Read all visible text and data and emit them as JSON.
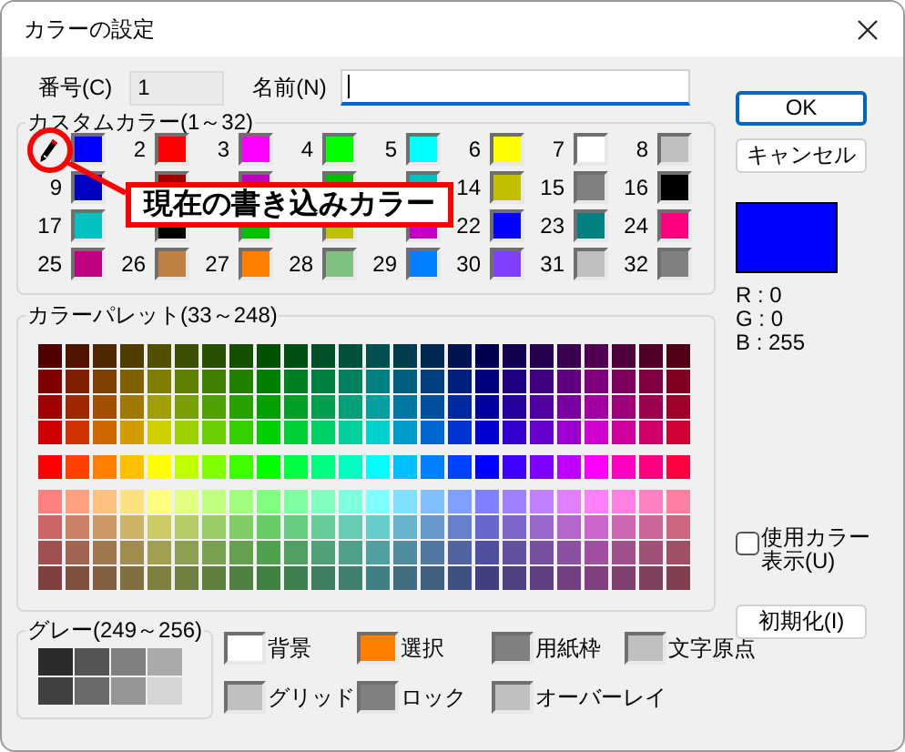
{
  "window": {
    "title": "カラーの設定"
  },
  "number_field": {
    "label": "番号(C)",
    "value": "1"
  },
  "name_field": {
    "label": "名前(N)",
    "focused": true
  },
  "custom_colors": {
    "title": "カスタムカラー(1～32)",
    "cells": [
      {
        "kind": "current",
        "color": "#0000ff"
      },
      {
        "kind": "number",
        "label": "2",
        "color": "#ff0000"
      },
      {
        "kind": "number",
        "label": "3",
        "color": "#ff00ff"
      },
      {
        "kind": "number",
        "label": "4",
        "color": "#00ff00"
      },
      {
        "kind": "number",
        "label": "5",
        "color": "#00ffff"
      },
      {
        "kind": "number",
        "label": "6",
        "color": "#ffff00"
      },
      {
        "kind": "number",
        "label": "7",
        "color": "#ffffff"
      },
      {
        "kind": "number",
        "label": "8",
        "color": "#c0c0c0"
      },
      {
        "kind": "number",
        "label": "9",
        "color": "#0000c0"
      },
      {
        "kind": "covered",
        "color": "#a00000"
      },
      {
        "kind": "covered",
        "color": "#c000c0"
      },
      {
        "kind": "covered",
        "color": "#00c000"
      },
      {
        "kind": "covered",
        "color": "#00c0c0"
      },
      {
        "kind": "number",
        "label": "14",
        "color": "#c0c000"
      },
      {
        "kind": "number",
        "label": "15",
        "color": "#808080"
      },
      {
        "kind": "number",
        "label": "16",
        "color": "#000000"
      },
      {
        "kind": "number",
        "label": "17",
        "color": "#00c0c0"
      },
      {
        "kind": "covered",
        "color": "#000000"
      },
      {
        "kind": "covered",
        "color": "#00c000"
      },
      {
        "kind": "covered",
        "color": "#c0c000"
      },
      {
        "kind": "covered",
        "color": "#c000c0"
      },
      {
        "kind": "number",
        "label": "22",
        "color": "#0000ff"
      },
      {
        "kind": "number",
        "label": "23",
        "color": "#008080"
      },
      {
        "kind": "number",
        "label": "24",
        "color": "#ff0080"
      },
      {
        "kind": "number",
        "label": "25",
        "color": "#c00080"
      },
      {
        "kind": "number",
        "label": "26",
        "color": "#c08040"
      },
      {
        "kind": "number",
        "label": "27",
        "color": "#ff8000"
      },
      {
        "kind": "number",
        "label": "28",
        "color": "#80c080"
      },
      {
        "kind": "number",
        "label": "29",
        "color": "#0080ff"
      },
      {
        "kind": "number",
        "label": "30",
        "color": "#8040ff"
      },
      {
        "kind": "number",
        "label": "31",
        "color": "#c0c0c0"
      },
      {
        "kind": "number",
        "label": "32",
        "color": "#808080"
      }
    ],
    "callout": "現在の書き込みカラー"
  },
  "palette": {
    "title": "カラーパレット(33～248)",
    "bands": [
      {
        "rows": [
          {
            "cells": [
              {
                "color": "#500000"
              },
              {
                "color": "#501400"
              },
              {
                "color": "#502800"
              },
              {
                "color": "#503c00"
              },
              {
                "color": "#505000"
              },
              {
                "color": "#3c5000"
              },
              {
                "color": "#285000"
              },
              {
                "color": "#145000"
              },
              {
                "color": "#005000"
              },
              {
                "color": "#005014"
              },
              {
                "color": "#005028"
              },
              {
                "color": "#00503c"
              },
              {
                "color": "#005050"
              },
              {
                "color": "#003c50"
              },
              {
                "color": "#002850"
              },
              {
                "color": "#001450"
              },
              {
                "color": "#000050"
              },
              {
                "color": "#140050"
              },
              {
                "color": "#280050"
              },
              {
                "color": "#3c0050"
              },
              {
                "color": "#500050"
              },
              {
                "color": "#50003c"
              },
              {
                "color": "#500028"
              },
              {
                "color": "#500014"
              }
            ]
          },
          {
            "cells": [
              {
                "color": "#800000"
              },
              {
                "color": "#802000"
              },
              {
                "color": "#804000"
              },
              {
                "color": "#806000"
              },
              {
                "color": "#808000"
              },
              {
                "color": "#608000"
              },
              {
                "color": "#408000"
              },
              {
                "color": "#208000"
              },
              {
                "color": "#008000"
              },
              {
                "color": "#008020"
              },
              {
                "color": "#008040"
              },
              {
                "color": "#008060"
              },
              {
                "color": "#008080"
              },
              {
                "color": "#006080"
              },
              {
                "color": "#004080"
              },
              {
                "color": "#002080"
              },
              {
                "color": "#000080"
              },
              {
                "color": "#200080"
              },
              {
                "color": "#400080"
              },
              {
                "color": "#600080"
              },
              {
                "color": "#800080"
              },
              {
                "color": "#800060"
              },
              {
                "color": "#800040"
              },
              {
                "color": "#800020"
              }
            ]
          },
          {
            "cells": [
              {
                "color": "#a00000"
              },
              {
                "color": "#a02800"
              },
              {
                "color": "#a05000"
              },
              {
                "color": "#a07800"
              },
              {
                "color": "#a0a000"
              },
              {
                "color": "#78a000"
              },
              {
                "color": "#50a000"
              },
              {
                "color": "#28a000"
              },
              {
                "color": "#00a000"
              },
              {
                "color": "#00a028"
              },
              {
                "color": "#00a050"
              },
              {
                "color": "#00a078"
              },
              {
                "color": "#00a0a0"
              },
              {
                "color": "#0078a0"
              },
              {
                "color": "#0050a0"
              },
              {
                "color": "#0028a0"
              },
              {
                "color": "#0000a0"
              },
              {
                "color": "#2800a0"
              },
              {
                "color": "#5000a0"
              },
              {
                "color": "#7800a0"
              },
              {
                "color": "#a000a0"
              },
              {
                "color": "#a00078"
              },
              {
                "color": "#a00050"
              },
              {
                "color": "#a00028"
              }
            ]
          },
          {
            "cells": [
              {
                "color": "#d00000"
              },
              {
                "color": "#d03400"
              },
              {
                "color": "#d06800"
              },
              {
                "color": "#d09c00"
              },
              {
                "color": "#d0d000"
              },
              {
                "color": "#9cd000"
              },
              {
                "color": "#68d000"
              },
              {
                "color": "#34d000"
              },
              {
                "color": "#00d000"
              },
              {
                "color": "#00d034"
              },
              {
                "color": "#00d068"
              },
              {
                "color": "#00d09c"
              },
              {
                "color": "#00d0d0"
              },
              {
                "color": "#009cd0"
              },
              {
                "color": "#0068d0"
              },
              {
                "color": "#0034d0"
              },
              {
                "color": "#0000d0"
              },
              {
                "color": "#3400d0"
              },
              {
                "color": "#6800d0"
              },
              {
                "color": "#9c00d0"
              },
              {
                "color": "#d000d0"
              },
              {
                "color": "#d0009c"
              },
              {
                "color": "#d00068"
              },
              {
                "color": "#d00034"
              }
            ]
          }
        ]
      },
      {
        "rows": [
          {
            "cells": [
              {
                "color": "#ff0000"
              },
              {
                "color": "#ff4000"
              },
              {
                "color": "#ff8000"
              },
              {
                "color": "#ffc000"
              },
              {
                "color": "#ffff00"
              },
              {
                "color": "#c0ff00"
              },
              {
                "color": "#80ff00"
              },
              {
                "color": "#40ff00"
              },
              {
                "color": "#00ff00"
              },
              {
                "color": "#00ff40"
              },
              {
                "color": "#00ff80"
              },
              {
                "color": "#00ffc0"
              },
              {
                "color": "#00ffff"
              },
              {
                "color": "#00c0ff"
              },
              {
                "color": "#0080ff"
              },
              {
                "color": "#0040ff"
              },
              {
                "color": "#0000ff"
              },
              {
                "color": "#4000ff"
              },
              {
                "color": "#8000ff"
              },
              {
                "color": "#c000ff"
              },
              {
                "color": "#ff00ff"
              },
              {
                "color": "#ff00c0"
              },
              {
                "color": "#ff0080"
              },
              {
                "color": "#ff0040"
              }
            ]
          }
        ]
      },
      {
        "rows": [
          {
            "cells": [
              {
                "color": "#ff8080"
              },
              {
                "color": "#ffa080"
              },
              {
                "color": "#ffc080"
              },
              {
                "color": "#ffe080"
              },
              {
                "color": "#ffff80"
              },
              {
                "color": "#e0ff80"
              },
              {
                "color": "#c0ff80"
              },
              {
                "color": "#a0ff80"
              },
              {
                "color": "#80ff80"
              },
              {
                "color": "#80ffa0"
              },
              {
                "color": "#80ffc0"
              },
              {
                "color": "#80ffe0"
              },
              {
                "color": "#80ffff"
              },
              {
                "color": "#80e0ff"
              },
              {
                "color": "#80c0ff"
              },
              {
                "color": "#80a0ff"
              },
              {
                "color": "#8080ff"
              },
              {
                "color": "#a080ff"
              },
              {
                "color": "#c080ff"
              },
              {
                "color": "#e080ff"
              },
              {
                "color": "#ff80ff"
              },
              {
                "color": "#ff80e0"
              },
              {
                "color": "#ff80c0"
              },
              {
                "color": "#ff80a0"
              }
            ]
          },
          {
            "cells": [
              {
                "color": "#cc6666"
              },
              {
                "color": "#cc8066"
              },
              {
                "color": "#cc9966"
              },
              {
                "color": "#ccb366"
              },
              {
                "color": "#cccc66"
              },
              {
                "color": "#b3cc66"
              },
              {
                "color": "#99cc66"
              },
              {
                "color": "#80cc66"
              },
              {
                "color": "#66cc66"
              },
              {
                "color": "#66cc80"
              },
              {
                "color": "#66cc99"
              },
              {
                "color": "#66ccb3"
              },
              {
                "color": "#66cccc"
              },
              {
                "color": "#66b3cc"
              },
              {
                "color": "#6699cc"
              },
              {
                "color": "#6680cc"
              },
              {
                "color": "#6666cc"
              },
              {
                "color": "#8066cc"
              },
              {
                "color": "#9966cc"
              },
              {
                "color": "#b366cc"
              },
              {
                "color": "#cc66cc"
              },
              {
                "color": "#cc66b3"
              },
              {
                "color": "#cc6699"
              },
              {
                "color": "#cc6680"
              }
            ]
          },
          {
            "cells": [
              {
                "color": "#a05050"
              },
              {
                "color": "#a06450"
              },
              {
                "color": "#a07850"
              },
              {
                "color": "#a08c50"
              },
              {
                "color": "#a0a050"
              },
              {
                "color": "#8ca050"
              },
              {
                "color": "#78a050"
              },
              {
                "color": "#64a050"
              },
              {
                "color": "#50a050"
              },
              {
                "color": "#50a064"
              },
              {
                "color": "#50a078"
              },
              {
                "color": "#50a08c"
              },
              {
                "color": "#50a0a0"
              },
              {
                "color": "#508ca0"
              },
              {
                "color": "#5078a0"
              },
              {
                "color": "#5064a0"
              },
              {
                "color": "#5050a0"
              },
              {
                "color": "#6450a0"
              },
              {
                "color": "#7850a0"
              },
              {
                "color": "#8c50a0"
              },
              {
                "color": "#a050a0"
              },
              {
                "color": "#a0508c"
              },
              {
                "color": "#a05078"
              },
              {
                "color": "#a05064"
              }
            ]
          },
          {
            "cells": [
              {
                "color": "#804040"
              },
              {
                "color": "#805040"
              },
              {
                "color": "#806040"
              },
              {
                "color": "#807040"
              },
              {
                "color": "#808040"
              },
              {
                "color": "#708040"
              },
              {
                "color": "#608040"
              },
              {
                "color": "#508040"
              },
              {
                "color": "#408040"
              },
              {
                "color": "#408050"
              },
              {
                "color": "#408060"
              },
              {
                "color": "#408070"
              },
              {
                "color": "#408080"
              },
              {
                "color": "#407080"
              },
              {
                "color": "#406080"
              },
              {
                "color": "#405080"
              },
              {
                "color": "#404080"
              },
              {
                "color": "#504080"
              },
              {
                "color": "#604080"
              },
              {
                "color": "#704080"
              },
              {
                "color": "#804080"
              },
              {
                "color": "#804070"
              },
              {
                "color": "#804060"
              },
              {
                "color": "#804050"
              }
            ]
          }
        ]
      }
    ]
  },
  "gray": {
    "title": "グレー(249～256)",
    "cells": [
      {
        "color": "#2b2b2b"
      },
      {
        "color": "#555555"
      },
      {
        "color": "#808080"
      },
      {
        "color": "#aaaaaa"
      },
      {
        "color": "#404040"
      },
      {
        "color": "#6a6a6a"
      },
      {
        "color": "#959595"
      },
      {
        "color": "#d5d5d5"
      }
    ]
  },
  "system_colors": [
    {
      "label": "背景",
      "color": "#ffffff"
    },
    {
      "label": "選択",
      "color": "#ff8000"
    },
    {
      "label": "用紙枠",
      "color": "#808080"
    },
    {
      "label": "文字原点",
      "color": "#c0c0c0"
    },
    {
      "label": "グリッド",
      "color": "#c0c0c0"
    },
    {
      "label": "ロック",
      "color": "#808080"
    },
    {
      "label": "オーバーレイ",
      "color": "#c0c0c0"
    }
  ],
  "buttons": [
    {
      "label": "OK",
      "default": true
    },
    {
      "label": "キャンセル",
      "default": false
    }
  ],
  "preview": {
    "color": "#0000ff",
    "values": [
      "R : 0",
      "G : 0",
      "B : 255"
    ]
  },
  "show_used_colors": {
    "label": "使用カラー表示(U)",
    "checked": false
  },
  "reset_button": "初期化(I)"
}
